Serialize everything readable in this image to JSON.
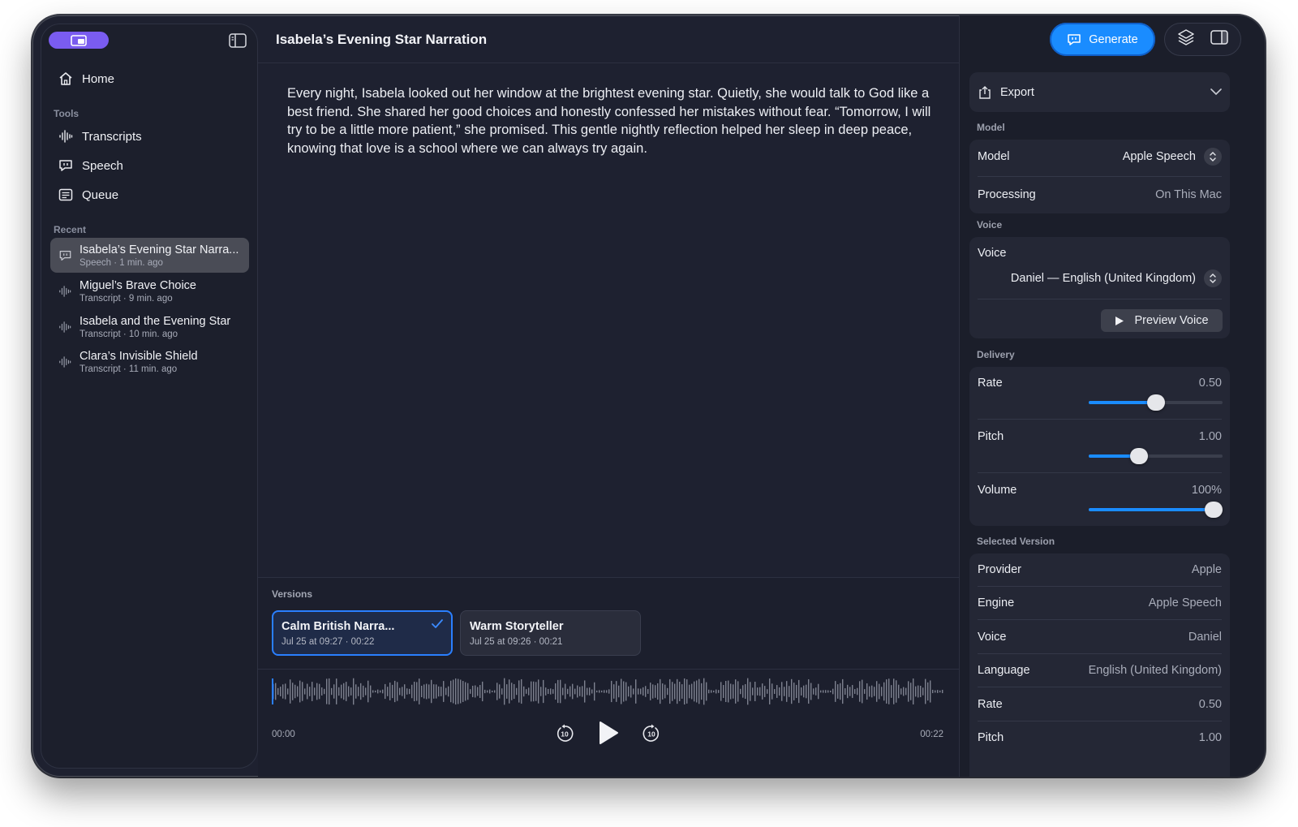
{
  "document": {
    "title": "Isabela’s Evening Star Narration",
    "body": "Every night, Isabela looked out her window at the brightest evening star. Quietly, she would talk to God like a best friend. She shared her good choices and honestly confessed her mistakes without fear. “Tomorrow, I will try to be a little more patient,” she promised. This gentle nightly reflection helped her sleep in deep peace, knowing that love is a school where we can always try again."
  },
  "sidebar": {
    "nav": [
      {
        "label": "Home",
        "icon": "house-icon"
      }
    ],
    "tools_label": "Tools",
    "tools": [
      {
        "label": "Transcripts",
        "icon": "waveform-icon"
      },
      {
        "label": "Speech",
        "icon": "speech-bubble-icon"
      },
      {
        "label": "Queue",
        "icon": "list-icon"
      }
    ],
    "recent_label": "Recent",
    "recent": [
      {
        "title": "Isabela’s Evening Star Narra...",
        "subtitle": "Speech · 1 min. ago",
        "icon": "speech-bubble-icon",
        "active": true
      },
      {
        "title": "Miguel’s Brave Choice",
        "subtitle": "Transcript · 9 min. ago",
        "icon": "waveform-icon",
        "active": false
      },
      {
        "title": "Isabela and the Evening Star",
        "subtitle": "Transcript · 10 min. ago",
        "icon": "waveform-icon",
        "active": false
      },
      {
        "title": "Clara’s Invisible Shield",
        "subtitle": "Transcript · 11 min. ago",
        "icon": "waveform-icon",
        "active": false
      }
    ]
  },
  "versions": {
    "label": "Versions",
    "items": [
      {
        "title": "Calm British Narra...",
        "meta": "Jul 25 at 09:27  ·  00:22",
        "selected": true
      },
      {
        "title": "Warm Storyteller",
        "meta": "Jul 25 at 09:26  ·  00:21",
        "selected": false
      }
    ]
  },
  "player": {
    "current_time": "00:00",
    "duration": "00:22",
    "skip_back": "10",
    "skip_forward": "10",
    "progress": 0.0
  },
  "right_panel": {
    "generate_label": "Generate",
    "export_label": "Export",
    "model_section": "Model",
    "model_label": "Model",
    "model_value": "Apple Speech",
    "processing_label": "Processing",
    "processing_value": "On This Mac",
    "voice_section": "Voice",
    "voice_label": "Voice",
    "voice_value": "Daniel — English (United Kingdom)",
    "preview_label": "Preview Voice",
    "delivery_section": "Delivery",
    "rate_label": "Rate",
    "rate_value": "0.50",
    "rate_level": 0.5,
    "pitch_label": "Pitch",
    "pitch_value": "1.00",
    "pitch_level": 0.36,
    "volume_label": "Volume",
    "volume_value": "100%",
    "volume_level": 1.0,
    "selected_section": "Selected Version",
    "details": [
      {
        "label": "Provider",
        "value": "Apple"
      },
      {
        "label": "Engine",
        "value": "Apple Speech"
      },
      {
        "label": "Voice",
        "value": "Daniel"
      },
      {
        "label": "Language",
        "value": "English (United Kingdom)"
      },
      {
        "label": "Rate",
        "value": "0.50"
      },
      {
        "label": "Pitch",
        "value": "1.00"
      }
    ]
  },
  "colors": {
    "accent": "#1a8cff",
    "sidebar_badge": "#7a5cf0",
    "window_bg": "#1e2130"
  }
}
